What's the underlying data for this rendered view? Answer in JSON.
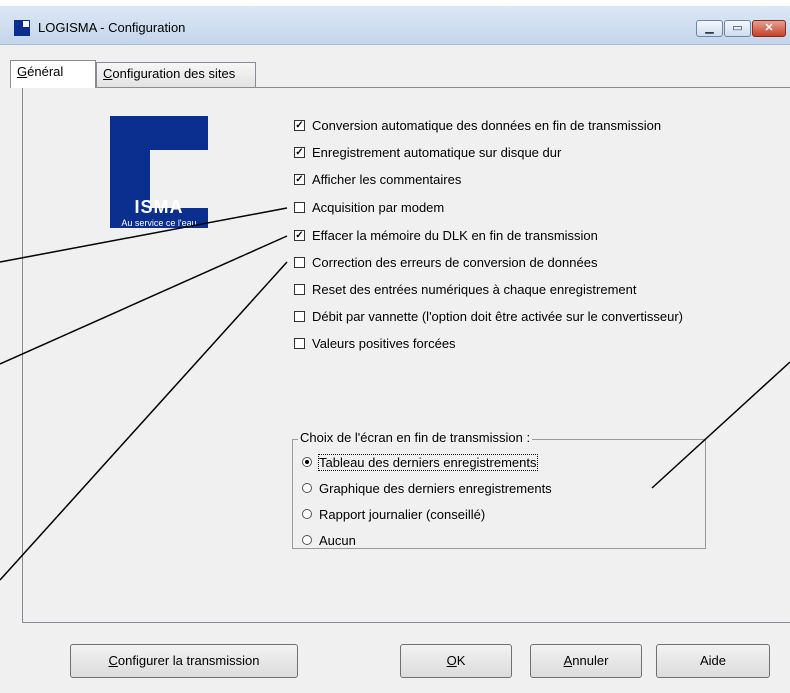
{
  "window": {
    "title": "LOGISMA - Configuration"
  },
  "tabs": [
    {
      "label_pre": "",
      "label_u": "G",
      "label_post": "énéral",
      "active": true
    },
    {
      "label_pre": "",
      "label_u": "C",
      "label_post": "onfiguration des sites",
      "active": false
    }
  ],
  "logo": {
    "text": "ISMA",
    "tagline": "Au service ce l'eau"
  },
  "options": [
    {
      "label": "Conversion automatique des données en fin de transmission",
      "checked": true
    },
    {
      "label": "Enregistrement automatique sur disque dur",
      "checked": true
    },
    {
      "label": "Afficher les commentaires",
      "checked": true
    },
    {
      "label": "Acquisition par modem",
      "checked": false
    },
    {
      "label": "Effacer la  mémoire du DLK en fin de transmission",
      "checked": true
    },
    {
      "label": "Correction des erreurs de conversion de données",
      "checked": false
    },
    {
      "label": "Reset des entrées numériques à chaque enregistrement",
      "checked": false
    },
    {
      "label": "Débit par vannette (l'option doit être activée sur le convertisseur)",
      "checked": false
    },
    {
      "label": "Valeurs positives forcées",
      "checked": false
    }
  ],
  "screen_choice": {
    "title": "Choix de l'écran en fin de transmission :",
    "options": [
      {
        "label": "Tableau des derniers enregistrements",
        "selected": true
      },
      {
        "label": "Graphique des derniers enregistrements",
        "selected": false
      },
      {
        "label": "Rapport journalier (conseillé)",
        "selected": false
      },
      {
        "label": "Aucun",
        "selected": false
      }
    ]
  },
  "buttons": {
    "configure": {
      "pre": "",
      "u": "C",
      "post": "onfigurer la transmission"
    },
    "ok": {
      "pre": "",
      "u": "O",
      "post": "K"
    },
    "cancel": {
      "pre": "",
      "u": "A",
      "post": "nnuler"
    },
    "help": {
      "pre": "Aide",
      "u": "",
      "post": ""
    }
  },
  "colors": {
    "logo_blue": "#0a2f8f",
    "titlebar": "#c4d6ec",
    "close_red": "#c4412b"
  }
}
